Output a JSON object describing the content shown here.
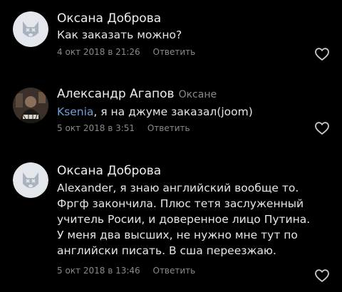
{
  "comments": [
    {
      "author": "Оксана Доброва",
      "reply_to": "",
      "mention": "",
      "lines": [
        "Как заказать можно?"
      ],
      "date": "4 окт 2018 в 21:26",
      "reply_label": "Ответить",
      "avatar": "deactivated-dog-avatar",
      "like_icon": "heart-outline-icon"
    },
    {
      "author": "Александр Агапов",
      "reply_to": "Оксане",
      "mention": "Ksenia",
      "lines": [
        ", я на джуме заказал(joom)"
      ],
      "date": "5 окт 2018 в 3:51",
      "reply_label": "Ответить",
      "avatar": "user-photo-avatar",
      "like_icon": "heart-outline-icon"
    },
    {
      "author": "Оксана Доброва",
      "reply_to": "",
      "mention": "",
      "lines": [
        "Alexander, я знаю английский вообще то.",
        "Фргф закончила. Плюс тетя заслуженный",
        "учитель Росии, и доверенное лицо Путина.",
        "У меня два высших, не нужно мне тут по",
        "английски писать. В сша переезжаю."
      ],
      "date": "5 окт 2018 в 13:46",
      "reply_label": "Ответить",
      "avatar": "deactivated-dog-avatar",
      "like_icon": "heart-outline-icon"
    }
  ],
  "colors": {
    "background": "#000000",
    "text": "#e6e6e6",
    "secondary": "#8a8a8a",
    "mention": "#6f9fd8",
    "avatar_placeholder": "#e3e7ec"
  }
}
